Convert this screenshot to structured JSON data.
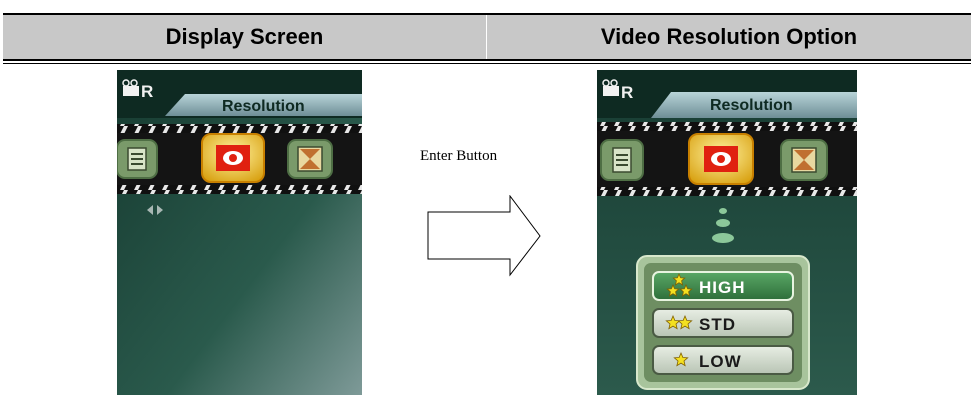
{
  "table": {
    "header_left": "Display Screen",
    "header_right": "Video Resolution Option"
  },
  "camera_ui": {
    "mode_letter": "R",
    "tab_title": "Resolution",
    "menu_icons": [
      "list-icon",
      "record-icon",
      "hourglass-icon"
    ],
    "nav_hint_icon": "left-right-arrows-icon"
  },
  "enter_button_label": "Enter Button",
  "resolution_options": [
    {
      "label": "HIGH",
      "stars": 3,
      "selected": true
    },
    {
      "label": "STD",
      "stars": 2,
      "selected": false
    },
    {
      "label": "LOW",
      "stars": 1,
      "selected": false
    }
  ],
  "colors": {
    "header_band": "#c8c8c8",
    "screen_bg": "#1e4a3c",
    "selected_icon": "#e8c020",
    "selected_option": "#3c8a4a"
  }
}
